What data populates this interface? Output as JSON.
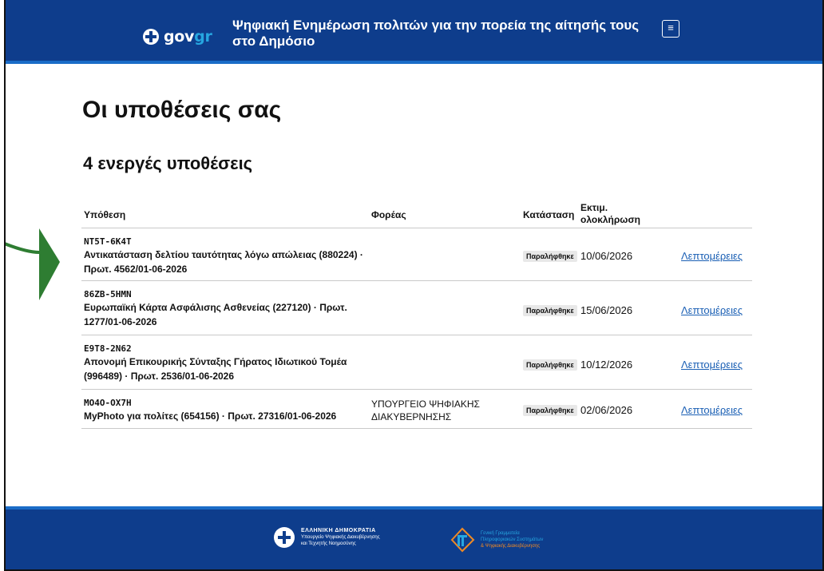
{
  "header": {
    "brand_prefix": "gov",
    "brand_suffix": "gr",
    "title": "Ψηφιακή Ενημέρωση πολιτών για την πορεία της αίτησής τους στο Δημόσιο",
    "menu_icon": "≡"
  },
  "main": {
    "page_title": "Οι υποθέσεις σας",
    "section_title": "4 ενεργές υποθέσεις",
    "columns": {
      "case": "Υπόθεση",
      "agency": "Φορέας",
      "status": "Κατάσταση",
      "estimate": "Εκτιμ. ολοκλήρωση"
    },
    "rows": [
      {
        "code": "NT5T-6K4T",
        "description": "Αντικατάσταση δελτίου ταυτότητας λόγω απώλειας (880224) · Πρωτ. 4562/01-06-2026",
        "agency": "",
        "status": "Παραλήφθηκε",
        "date": "10/06/2026",
        "link": "Λεπτομέρειες"
      },
      {
        "code": "86ZB-5HMN",
        "description": "Ευρωπαϊκή Κάρτα Ασφάλισης Ασθενείας (227120) · Πρωτ. 1277/01-06-2026",
        "agency": "",
        "status": "Παραλήφθηκε",
        "date": "15/06/2026",
        "link": "Λεπτομέρειες"
      },
      {
        "code": "E9T8-2N62",
        "description": "Απονομή Επικουρικής Σύνταξης Γήρατος Ιδιωτικού Τομέα (996489) · Πρωτ. 2536/01-06-2026",
        "agency": "",
        "status": "Παραλήφθηκε",
        "date": "10/12/2026",
        "link": "Λεπτομέρειες"
      },
      {
        "code": "MO4O-OX7H",
        "description": "MyPhoto για πολίτες (654156) · Πρωτ. 27316/01-06-2026",
        "agency": "ΥΠΟΥΡΓΕΙΟ ΨΗΦΙΑΚΗΣ ΔΙΑΚΥΒΕΡΝΗΣΗΣ",
        "status": "Παραλήφθηκε",
        "date": "02/06/2026",
        "link": "Λεπτομέρειες"
      }
    ]
  },
  "footer": {
    "republic": "ΕΛΛΗΝΙΚΗ ΔΗΜΟΚΡΑΤΙΑ",
    "ministry_line1": "Υπουργείο Ψηφιακής Διακυβέρνησης",
    "ministry_line2": "και Τεχνητής Νοημοσύνης",
    "gs_line1": "Γενική Γραμματεία",
    "gs_line2": "Πληροφοριακών Συστημάτων",
    "gs_line3": "& Ψηφιακής Διακυβέρνησης"
  },
  "colors": {
    "header_bg": "#0e3d8c",
    "accent": "#1a6cc7",
    "arrow": "#2e7d32",
    "link": "#1a5fb4"
  }
}
